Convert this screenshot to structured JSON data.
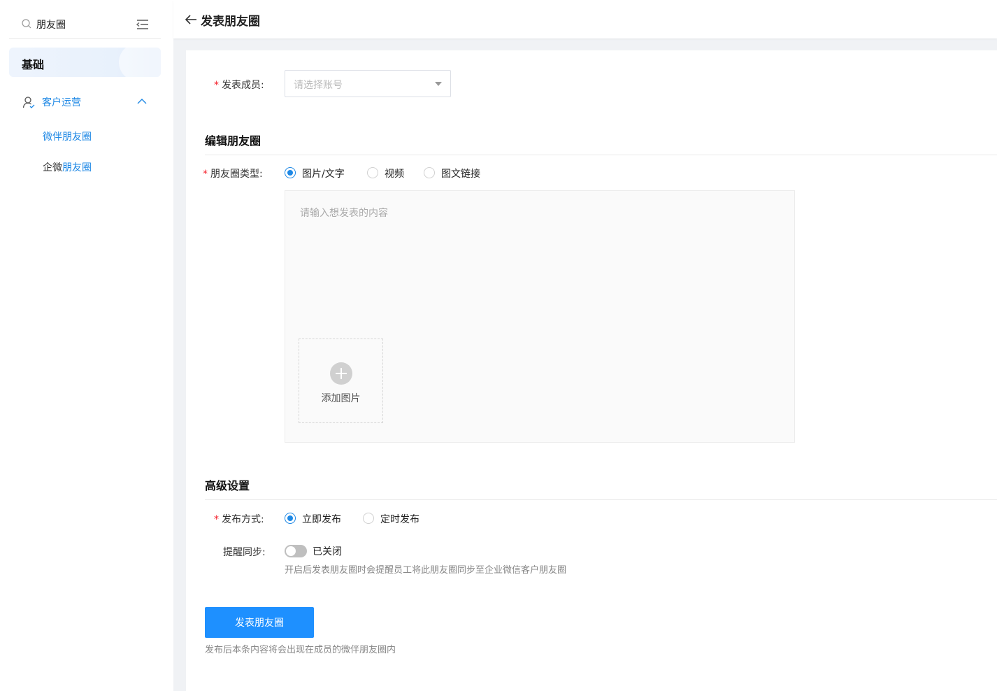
{
  "sidebar": {
    "search_text": "朋友圈",
    "basic_label": "基础",
    "group_label": "客户运营",
    "items": [
      {
        "label": "微伴朋友圈"
      },
      {
        "label_prefix": "企微",
        "label_highlight": "朋友圈"
      }
    ]
  },
  "header": {
    "title": "发表朋友圈"
  },
  "form": {
    "member_label": "发表成员:",
    "member_placeholder": "请选择账号",
    "edit_section_title": "编辑朋友圈",
    "type_label": "朋友圈类型:",
    "type_options": [
      "图片/文字",
      "视频",
      "图文链接"
    ],
    "type_selected": "图片/文字",
    "content_placeholder": "请输入想发表的内容",
    "add_image_label": "添加图片",
    "advanced_section_title": "高级设置",
    "publish_label": "发布方式:",
    "publish_options": [
      "立即发布",
      "定时发布"
    ],
    "publish_selected": "立即发布",
    "remind_label": "提醒同步:",
    "remind_status": "已关闭",
    "remind_hint": "开启后发表朋友圈时会提醒员工将此朋友圈同步至企业微信客户朋友圈",
    "submit_label": "发表朋友圈",
    "submit_hint": "发布后本条内容将会出现在成员的微伴朋友圈内"
  },
  "colors": {
    "accent": "#1e88e5",
    "primary_button": "#1e90ff",
    "required": "#f5222d"
  }
}
